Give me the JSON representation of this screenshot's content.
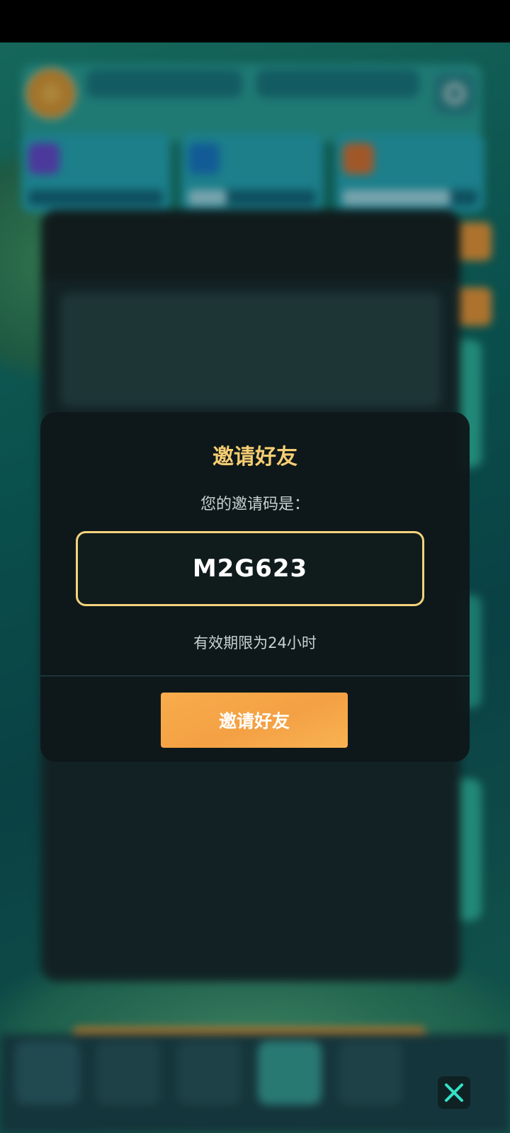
{
  "dialog": {
    "title": "邀请好友",
    "code_label": "您的邀请码是：",
    "invite_code": "M2G623",
    "expiry_text": "有效期限为24小时",
    "invite_button_label": "邀请好友"
  },
  "controls": {
    "close_icon": "close-x-icon"
  },
  "colors": {
    "accent_gold": "#f6cd72",
    "button_orange": "#f4a044",
    "close_icon": "#35e0c8"
  }
}
